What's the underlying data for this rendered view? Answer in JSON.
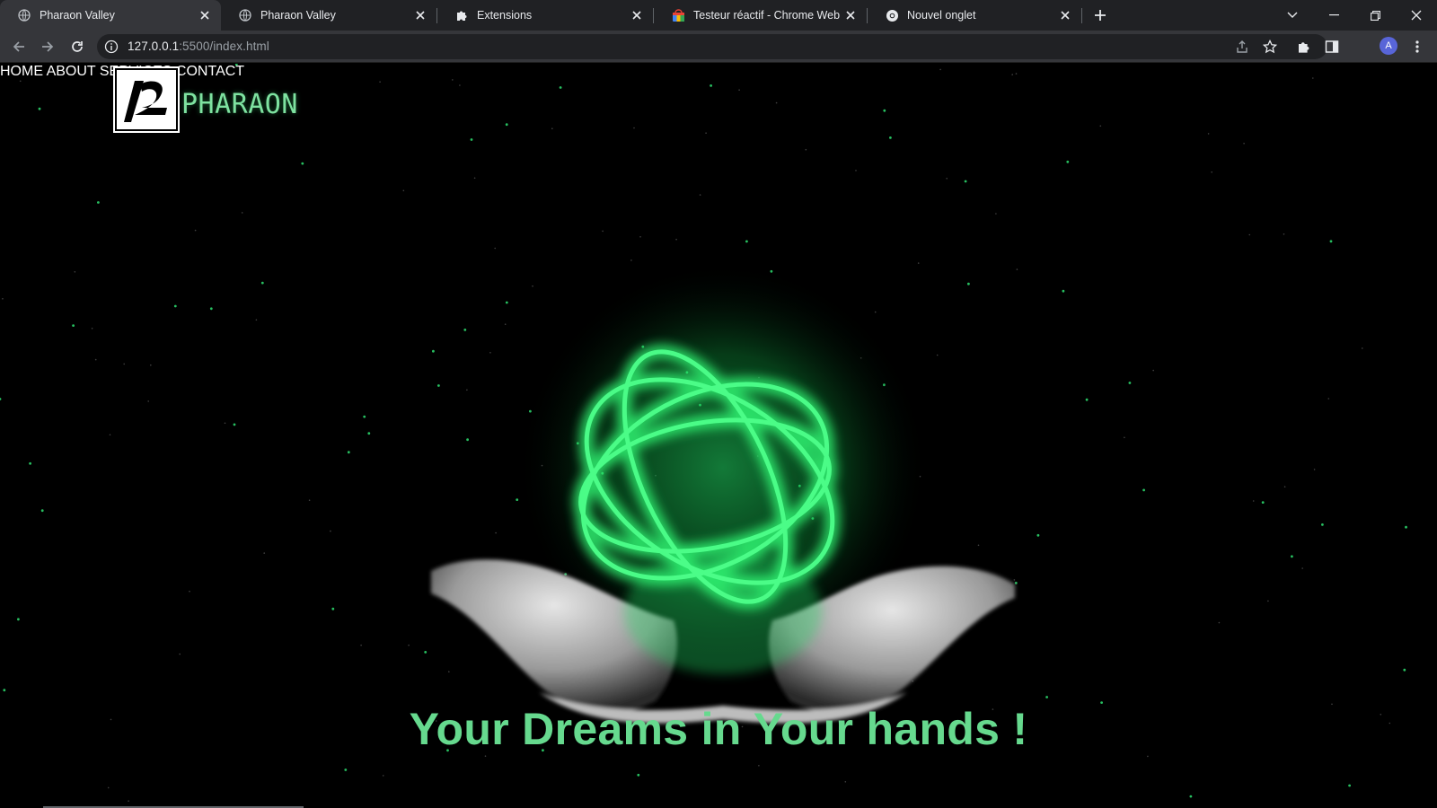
{
  "browser": {
    "tabs": [
      {
        "title": "Pharaon Valley",
        "icon": "globe-icon",
        "active": true
      },
      {
        "title": "Pharaon Valley",
        "icon": "globe-icon",
        "active": false
      },
      {
        "title": "Extensions",
        "icon": "puzzle-icon",
        "active": false
      },
      {
        "title": "Testeur réactif - Chrome Web Sto",
        "icon": "webstore-icon",
        "active": false
      },
      {
        "title": "Nouvel onglet",
        "icon": "chrome-icon",
        "active": false
      }
    ],
    "url_host": "127.0.0.1",
    "url_rest": ":5500/index.html",
    "profile_initial": "A",
    "colors": {
      "tabstrip": "#202124",
      "toolbar": "#35363a",
      "omnibox": "#202124"
    }
  },
  "site": {
    "brand": "PHARAON",
    "logo_letter": "p",
    "nav": [
      {
        "label": "HOME"
      },
      {
        "label": "ABOUT"
      },
      {
        "label": "SERVICES"
      },
      {
        "label": "CONTACT"
      }
    ],
    "hero_title": "Your Dreams in Your hands !",
    "colors": {
      "accent": "#66d98e",
      "background": "#000000",
      "glow": "#22dd66"
    }
  }
}
